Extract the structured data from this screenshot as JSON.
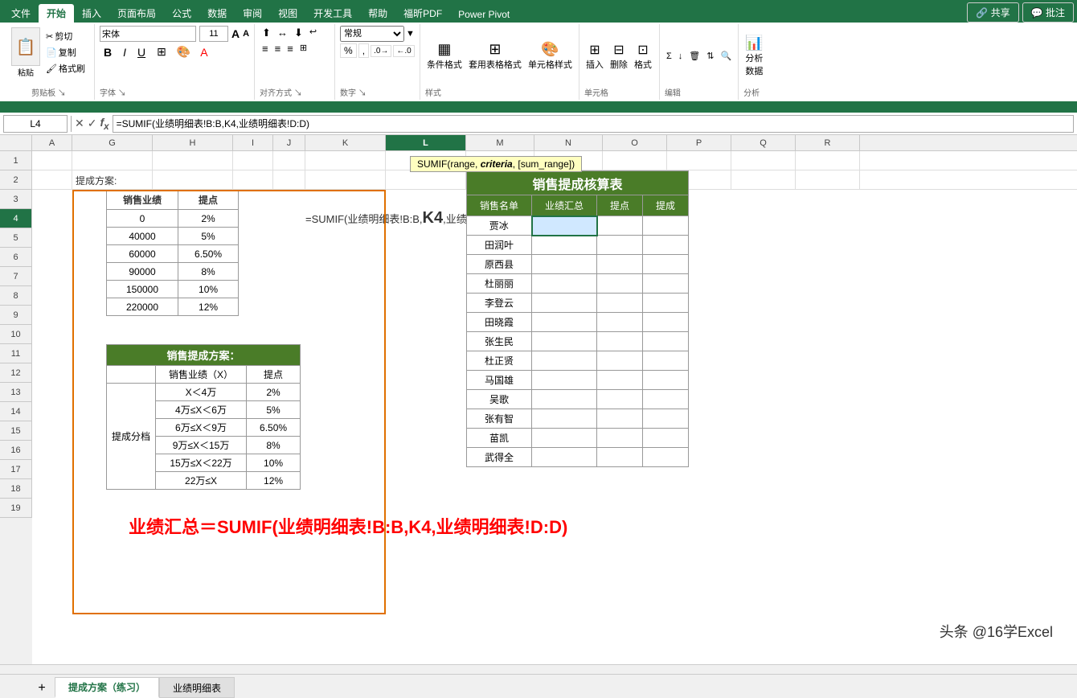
{
  "ribbon": {
    "tabs": [
      "文件",
      "开始",
      "插入",
      "页面布局",
      "公式",
      "数据",
      "审阅",
      "视图",
      "开发工具",
      "帮助",
      "福昕PDF",
      "Power Pivot"
    ],
    "active_tab": "开始",
    "share_btn": "共享",
    "comment_btn": "批注"
  },
  "formula_bar": {
    "cell_ref": "L4",
    "formula": "=SUMIF(业绩明细表!B:B,K4,业绩明细表!D:D)",
    "tooltip": "SUMIF(range, criteria, [sum_range])"
  },
  "col_headers": [
    "A",
    "G",
    "H",
    "I",
    "J",
    "K",
    "L",
    "M",
    "N",
    "O",
    "P",
    "Q",
    "R"
  ],
  "row_headers": [
    "1",
    "2",
    "3",
    "4",
    "5",
    "6",
    "7",
    "8",
    "9",
    "10",
    "11",
    "12",
    "13",
    "14",
    "15",
    "16",
    "17",
    "18",
    "19"
  ],
  "left_table": {
    "title": "提成方案:",
    "headers": [
      "销售业绩",
      "提点"
    ],
    "rows": [
      [
        "0",
        "2%"
      ],
      [
        "40000",
        "5%"
      ],
      [
        "60000",
        "6.50%"
      ],
      [
        "90000",
        "8%"
      ],
      [
        "150000",
        "10%"
      ],
      [
        "220000",
        "12%"
      ]
    ]
  },
  "left_table2": {
    "title": "销售提成方案：",
    "headers": [
      "销售业绩（X）",
      "提点"
    ],
    "rows": [
      [
        "X＜4万",
        "2%"
      ],
      [
        "4万≤X＜6万",
        "5%"
      ],
      [
        "6万≤X＜9万",
        "6.50%"
      ],
      [
        "9万≤X＜15万",
        "8%"
      ],
      [
        "15万≤X＜22万",
        "10%"
      ],
      [
        "22万≤X",
        "12%"
      ]
    ],
    "side_label": "提成分档"
  },
  "sales_table": {
    "title": "销售提成核算表",
    "headers": [
      "销售名单",
      "业绩汇总",
      "提点",
      "提成"
    ],
    "rows": [
      [
        "贾冰",
        "",
        "",
        ""
      ],
      [
        "田润叶",
        "",
        "",
        ""
      ],
      [
        "原西县",
        "",
        "",
        ""
      ],
      [
        "杜丽丽",
        "",
        "",
        ""
      ],
      [
        "李登云",
        "",
        "",
        ""
      ],
      [
        "田晓霞",
        "",
        "",
        ""
      ],
      [
        "张生民",
        "",
        "",
        ""
      ],
      [
        "杜正贤",
        "",
        "",
        ""
      ],
      [
        "马国雄",
        "",
        "",
        ""
      ],
      [
        "吴歌",
        "",
        "",
        ""
      ],
      [
        "张有智",
        "",
        "",
        ""
      ],
      [
        "苗凯",
        "",
        "",
        ""
      ],
      [
        "武得全",
        "",
        "",
        ""
      ]
    ]
  },
  "formula_overlay": {
    "text1": "=SUMIF(业绩明细表!B:B,",
    "k4": "K4",
    "text2": ",业绩明细表!D:D"
  },
  "big_formula": {
    "text": "业绩汇总＝SUMIF(业绩明细表!B:B,K4,业绩明细表!D:D)"
  },
  "watermark": {
    "text": "头条 @16学Excel"
  },
  "sheet_tabs": [
    "提成方案（练习）",
    "业绩明细表"
  ],
  "active_sheet": "提成方案（练习）",
  "col_widths": {
    "A": 40,
    "G": 100,
    "H": 100,
    "I": 50,
    "J": 40,
    "K": 100,
    "L": 100,
    "M": 80,
    "N": 80,
    "O": 80,
    "P": 80,
    "Q": 80,
    "R": 80
  }
}
